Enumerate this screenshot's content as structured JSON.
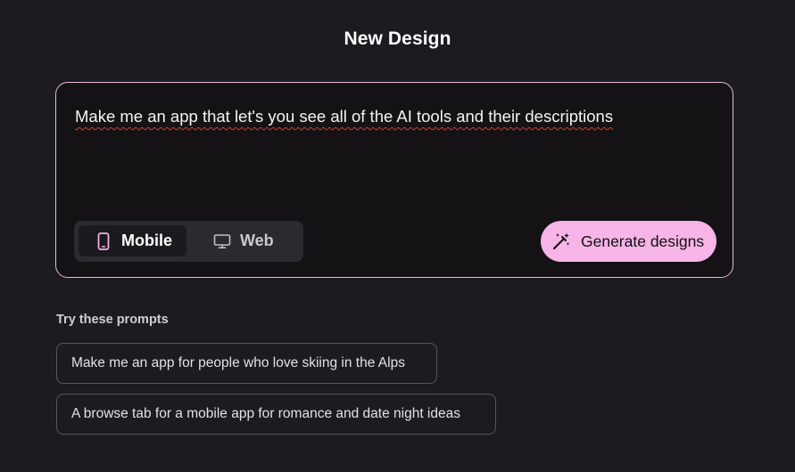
{
  "header": {
    "title": "New Design"
  },
  "composer": {
    "prompt_value": "Make me an app that let's you see all of the AI tools and their descriptions",
    "mode_toggle": {
      "options": [
        {
          "label": "Mobile",
          "icon": "smartphone-icon",
          "selected": true
        },
        {
          "label": "Web",
          "icon": "monitor-icon",
          "selected": false
        }
      ]
    },
    "generate_button": {
      "label": "Generate designs",
      "icon": "magic-wand-icon"
    }
  },
  "suggestions": {
    "heading": "Try these prompts",
    "items": [
      {
        "label": "Make me an app for people who love skiing in the Alps"
      },
      {
        "label": "A browse tab for a mobile app for romance and date night ideas"
      }
    ]
  },
  "colors": {
    "background": "#1c1c20",
    "composer_border": "#e9b6d9",
    "accent": "#f7b4e7"
  }
}
